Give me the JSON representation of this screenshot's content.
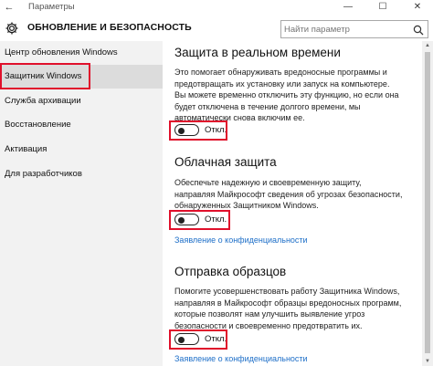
{
  "window": {
    "app_title": "Параметры",
    "back_glyph": "←",
    "minimize_glyph": "—",
    "maximize_glyph": "☐",
    "close_glyph": "✕"
  },
  "header": {
    "title": "ОБНОВЛЕНИЕ И БЕЗОПАСНОСТЬ",
    "search_placeholder": "Найти параметр"
  },
  "sidebar": {
    "items": [
      {
        "label": "Центр обновления Windows"
      },
      {
        "label": "Защитник Windows",
        "selected": true
      },
      {
        "label": "Служба архивации"
      },
      {
        "label": "Восстановление"
      },
      {
        "label": "Активация"
      },
      {
        "label": "Для разработчиков"
      }
    ]
  },
  "sections": [
    {
      "title": "Защита в реальном времени",
      "description": "Это помогает обнаруживать вредоносные программы и предотвращать их установку или запуск на компьютере. Вы можете временно отключить эту функцию, но если она будет отключена в течение долгого времени, мы автоматически снова включим ее.",
      "toggle_label": "Откл.",
      "toggle_on": false
    },
    {
      "title": "Облачная защита",
      "description": "Обеспечьте надежную и своевременную защиту, направляя Майкрософт сведения об угрозах безопасности, обнаруженных Защитником Windows.",
      "toggle_label": "Откл.",
      "toggle_on": false,
      "link": "Заявление о конфиденциальности"
    },
    {
      "title": "Отправка образцов",
      "description": "Помогите усовершенствовать работу Защитника Windows, направляя в Майкрософт образцы вредоносных программ, которые позволят нам улучшить выявление угроз безопасности и своевременно предотвратить их.",
      "toggle_label": "Откл.",
      "toggle_on": false,
      "link": "Заявление о конфиденциальности"
    }
  ],
  "colors": {
    "highlight": "#e0102b",
    "link": "#1e6fc8",
    "sidebar_bg": "#f2f2f2",
    "selected_bg": "#dcdcdc"
  }
}
